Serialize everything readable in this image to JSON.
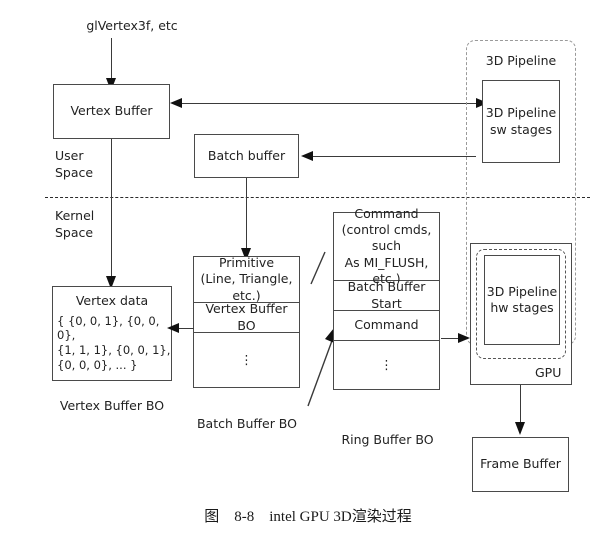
{
  "diagram": {
    "caption": "图    8-8    intel GPU 3D渲染过程",
    "space_labels": {
      "user": "User\nSpace",
      "kernel": "Kernel\nSpace"
    },
    "entry_label": "glVertex3f, etc",
    "boxes": {
      "vertex_buffer": "Vertex Buffer",
      "batch_buffer": "Batch buffer",
      "frame_buffer": "Frame Buffer",
      "pipeline_sw": "3D Pipeline\nsw stages",
      "pipeline_hw": "3D Pipeline\nhw stages",
      "pipeline_container_title": "3D Pipeline",
      "gpu_tag": "GPU"
    },
    "vertex_data": {
      "title": "Vertex data",
      "body": "{ {0, 0, 1}, {0, 0, 0},\n{1, 1, 1}, {0, 0, 1},\n{0, 0, 0}, ... }",
      "caption": "Vertex Buffer BO"
    },
    "batch_buffer_bo": {
      "caption": "Batch Buffer BO",
      "rows": [
        "Primitive\n(Line, Triangle, etc.)",
        "Vertex Buffer BO",
        "⋮"
      ]
    },
    "ring_buffer_bo": {
      "caption": "Ring Buffer BO",
      "rows": [
        "Command\n(control cmds, such\nAs MI_FLUSH, etc.)",
        "Batch Buffer Start",
        "Command",
        "⋮"
      ]
    },
    "colors": {
      "stroke": "#4a4a4a",
      "arrow": "#111111",
      "divider": "#2b2b2b",
      "pipeline_border": "#9a9a9a",
      "background": "#ffffff"
    }
  }
}
